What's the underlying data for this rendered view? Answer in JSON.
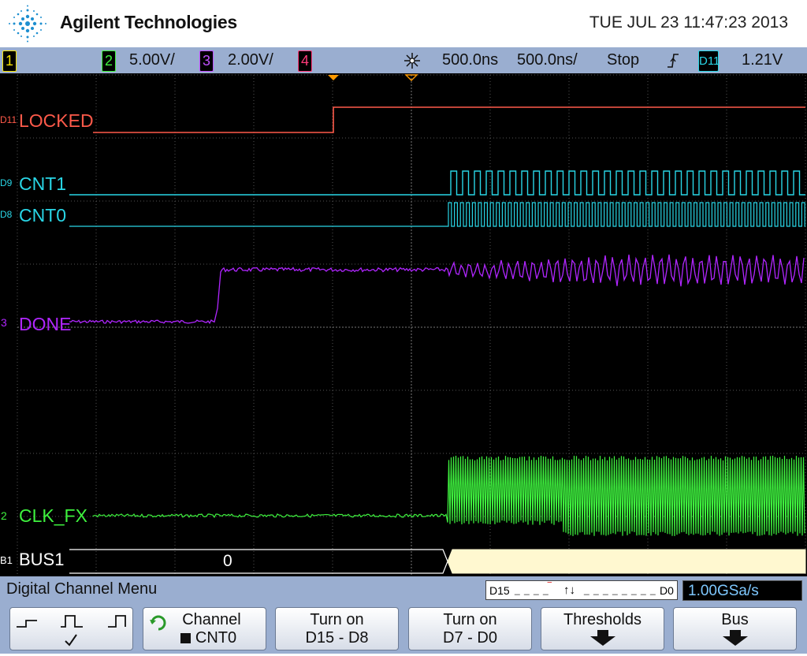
{
  "header": {
    "brand": "Agilent Technologies",
    "datetime": "TUE JUL 23 11:47:23 2013"
  },
  "status": {
    "ch1": "1",
    "ch2": "2",
    "ch2_scale": "5.00V/",
    "ch3": "3",
    "ch3_scale": "2.00V/",
    "ch4": "4",
    "delay": "500.0ns",
    "timebase": "500.0ns/",
    "run_state": "Stop",
    "trigger_source": "D11",
    "trigger_level": "1.21V"
  },
  "channels": {
    "locked": {
      "label": "LOCKED",
      "badge": "D11",
      "color": "#ff5a4a"
    },
    "cnt1": {
      "label": "CNT1",
      "badge": "D9",
      "color": "#29d6e6"
    },
    "cnt0": {
      "label": "CNT0",
      "badge": "D8",
      "color": "#29d6e6"
    },
    "done": {
      "label": "DONE",
      "badge": "3",
      "color": "#b026ff"
    },
    "clk_fx": {
      "label": "CLK_FX",
      "badge": "2",
      "color": "#3ef23e"
    },
    "bus1": {
      "label": "BUS1",
      "badge": "B1",
      "value": "0",
      "color": "#ffffff",
      "fill": "#fff8d0"
    }
  },
  "menu": {
    "title": "Digital Channel Menu",
    "thresh_left": "D15",
    "thresh_right": "D0",
    "sample_rate": "1.00GSa/s"
  },
  "softkeys": {
    "channel_l1": "Channel",
    "channel_l2": "CNT0",
    "d15_l1": "Turn on",
    "d15_l2": "D15 - D8",
    "d7_l1": "Turn on",
    "d7_l2": "D7 - D0",
    "thresholds": "Thresholds",
    "bus": "Bus"
  }
}
